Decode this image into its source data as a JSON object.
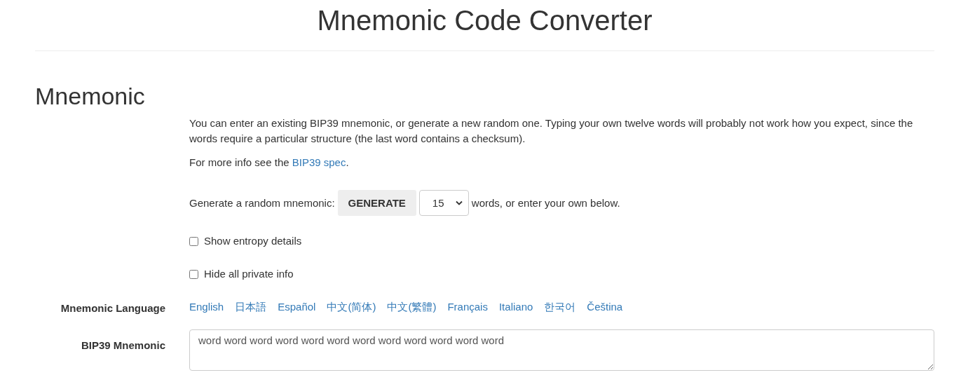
{
  "page_title": "Mnemonic Code Converter",
  "section": {
    "title": "Mnemonic",
    "intro": "You can enter an existing BIP39 mnemonic, or generate a new random one. Typing your own twelve words will probably not work how you expect, since the words require a particular structure (the last word contains a checksum).",
    "info": {
      "before": "For more info see the ",
      "link": "BIP39 spec",
      "after": "."
    },
    "generate": {
      "label": "Generate a random mnemonic:",
      "button": "GENERATE",
      "word_count": "15",
      "suffix": "words, or enter your own below."
    },
    "options": [
      {
        "label": "Show entropy details",
        "checked": false
      },
      {
        "label": "Hide all private info",
        "checked": false
      }
    ],
    "language": {
      "label": "Mnemonic Language",
      "links": [
        "English",
        "日本語",
        "Español",
        "中文(简体)",
        "中文(繁體)",
        "Français",
        "Italiano",
        "한국어",
        "Čeština"
      ]
    },
    "mnemonic": {
      "label": "BIP39 Mnemonic",
      "value": "word word word word word word word word word word word word"
    }
  }
}
